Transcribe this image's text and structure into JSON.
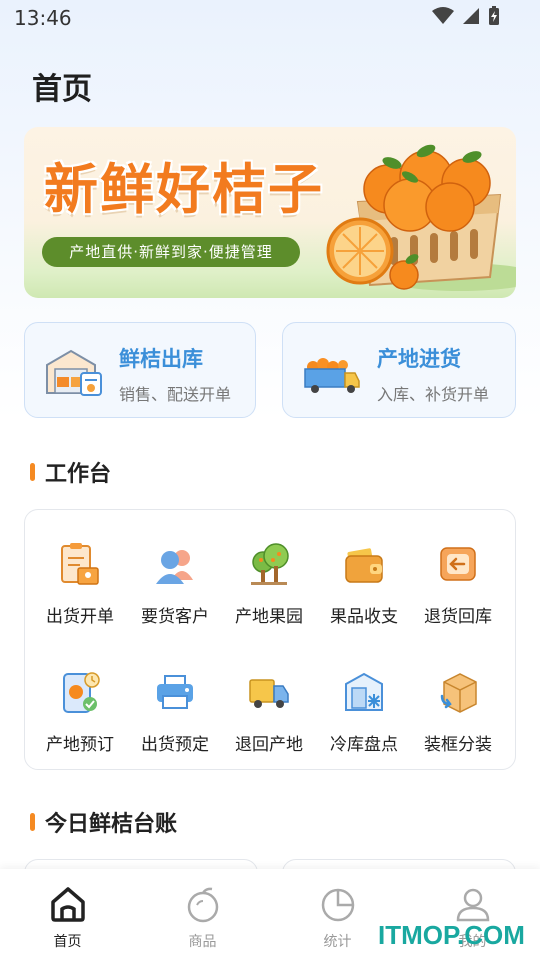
{
  "status": {
    "time": "13:46"
  },
  "page": {
    "title": "首页"
  },
  "banner": {
    "title": "新鲜好桔子",
    "subtitle": "产地直供·新鲜到家·便捷管理"
  },
  "quick_cards": [
    {
      "title": "鲜桔出库",
      "subtitle": "销售、配送开单",
      "icon": "warehouse-icon"
    },
    {
      "title": "产地进货",
      "subtitle": "入库、补货开单",
      "icon": "truck-oranges-icon"
    }
  ],
  "workbench": {
    "title": "工作台",
    "items": [
      {
        "label": "出货开单",
        "icon": "clipboard-order-icon"
      },
      {
        "label": "要货客户",
        "icon": "customers-icon"
      },
      {
        "label": "产地果园",
        "icon": "orchard-icon"
      },
      {
        "label": "果品收支",
        "icon": "wallet-icon"
      },
      {
        "label": "退货回库",
        "icon": "return-box-icon"
      },
      {
        "label": "产地预订",
        "icon": "phone-preorder-icon"
      },
      {
        "label": "出货预定",
        "icon": "printer-icon"
      },
      {
        "label": "退回产地",
        "icon": "delivery-truck-icon"
      },
      {
        "label": "冷库盘点",
        "icon": "cold-storage-icon"
      },
      {
        "label": "装框分装",
        "icon": "packing-box-icon"
      }
    ]
  },
  "ledger": {
    "title": "今日鲜桔台账"
  },
  "tabbar": {
    "items": [
      {
        "label": "首页",
        "icon": "home-icon",
        "active": true
      },
      {
        "label": "商品",
        "icon": "orange-fruit-icon",
        "active": false
      },
      {
        "label": "统计",
        "icon": "pie-chart-icon",
        "active": false
      },
      {
        "label": "我的",
        "icon": "user-icon",
        "active": false
      }
    ]
  },
  "watermark": "ITMOP.COM",
  "colors": {
    "accent_blue": "#3b8fd9",
    "accent_orange": "#f58a22",
    "banner_green": "#5d8d2b"
  }
}
